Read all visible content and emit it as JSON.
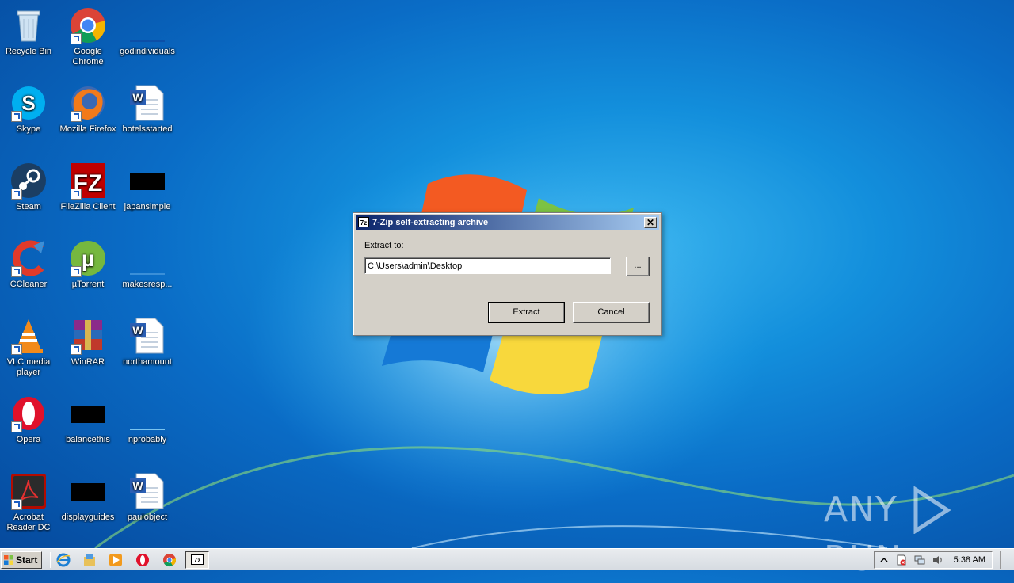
{
  "desktop": {
    "icons": [
      {
        "label": "Recycle Bin",
        "icon": "recycle-bin-icon"
      },
      {
        "label": "Google Chrome",
        "icon": "chrome-icon"
      },
      {
        "label": "godindividuals",
        "icon": "blank-file-icon"
      },
      {
        "label": "Skype",
        "icon": "skype-icon"
      },
      {
        "label": "Mozilla Firefox",
        "icon": "firefox-icon"
      },
      {
        "label": "hotelsstarted",
        "icon": "word-document-icon"
      },
      {
        "label": "Steam",
        "icon": "steam-icon"
      },
      {
        "label": "FileZilla Client",
        "icon": "filezilla-icon"
      },
      {
        "label": "japansimple",
        "icon": "black-file-icon"
      },
      {
        "label": "CCleaner",
        "icon": "ccleaner-icon"
      },
      {
        "label": "µTorrent",
        "icon": "utorrent-icon"
      },
      {
        "label": "makesresp...",
        "icon": "blank-file-icon"
      },
      {
        "label": "VLC media player",
        "icon": "vlc-icon"
      },
      {
        "label": "WinRAR",
        "icon": "winrar-icon"
      },
      {
        "label": "northamount",
        "icon": "word-document-icon"
      },
      {
        "label": "Opera",
        "icon": "opera-icon"
      },
      {
        "label": "balancethis",
        "icon": "black-file-icon"
      },
      {
        "label": "nprobably",
        "icon": "blank-file-icon"
      },
      {
        "label": "Acrobat Reader DC",
        "icon": "acrobat-icon"
      },
      {
        "label": "displayguides",
        "icon": "black-file-icon"
      },
      {
        "label": "paulobject",
        "icon": "word-document-icon"
      }
    ]
  },
  "dialog": {
    "title": "7-Zip self-extracting archive",
    "title_icon_text": "7z",
    "close_label": "✕",
    "extract_to_label": "Extract to:",
    "path_value": "C:\\Users\\admin\\Desktop",
    "browse_label": "...",
    "extract_label": "Extract",
    "cancel_label": "Cancel"
  },
  "watermark": {
    "left": "ANY",
    "right": "RUN"
  },
  "taskbar": {
    "start_label": "Start",
    "quick_launch": [
      "internet-explorer-icon",
      "file-explorer-icon",
      "media-player-icon",
      "opera-icon",
      "chrome-icon"
    ],
    "active_task_icon_text": "7z",
    "tray_icons": [
      "show-hidden-icons-icon",
      "action-center-icon",
      "network-icon",
      "volume-icon"
    ],
    "clock": "5:38 AM"
  },
  "colors": {
    "titlebar_start": "#0a246a",
    "titlebar_end": "#a6caf0",
    "dialog_bg": "#d4d0c8",
    "desktop_blue": "#138fdc"
  }
}
